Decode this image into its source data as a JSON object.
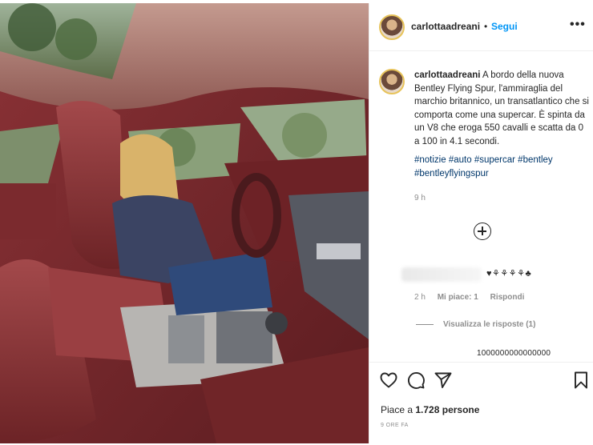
{
  "post": {
    "username": "carlottaadreani",
    "separator": "•",
    "follow_label": "Segui",
    "more_label": "•••",
    "caption_text": "A bordo della nuova Bentley Flying Spur, l'ammiraglia del marchio britannico, un transatlantico che si comporta come una supercar. È spinta da un V8 che eroga 550 cavalli e scatta da 0 a 100 in 4.1 secondi.",
    "hashtags": [
      "#notizie",
      "#auto",
      "#supercar",
      "#bentley",
      "#bentleyflyingspur"
    ],
    "caption_time": "9 h"
  },
  "comment": {
    "emojis": "♥⚘⚘⚘⚘♣",
    "time": "2 h",
    "likes": "Mi piace: 1",
    "reply_label": "Rispondi",
    "view_replies": "Visualizza le risposte (1)",
    "cut_text": "1000000000000000"
  },
  "footer": {
    "likes_prefix": "Piace a",
    "likes_count": "1.728",
    "likes_suffix": "persone",
    "ago": "9 ORE FA"
  },
  "icons": {
    "like": "heart-icon",
    "comment": "comment-icon",
    "share": "share-icon",
    "save": "bookmark-icon",
    "add": "plus-circle-icon"
  },
  "colors": {
    "link": "#0095f6",
    "hashtag": "#00376b",
    "muted": "#8e8e8e",
    "interior": "#7a2a2e"
  }
}
